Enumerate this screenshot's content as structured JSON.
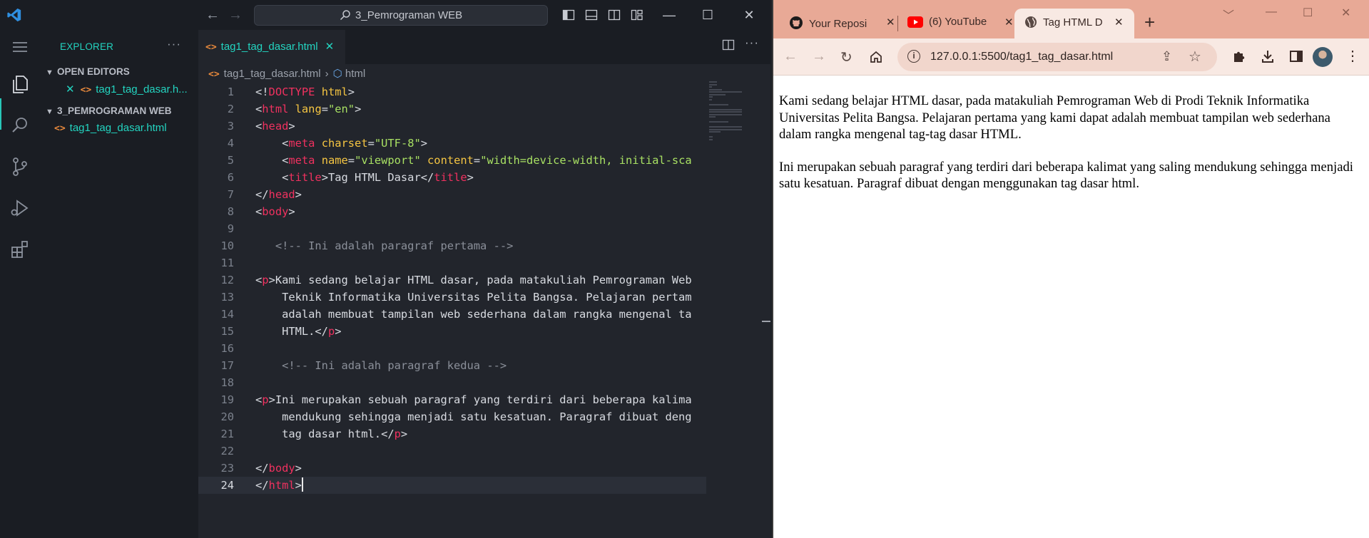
{
  "vscode": {
    "search_text": "3_Pemrograman WEB",
    "explorer_title": "EXPLORER",
    "open_editors_label": "OPEN EDITORS",
    "open_editor_file": "tag1_tag_dasar.h...",
    "folder_label": "3_PEMROGRAMAN WEB",
    "folder_file": "tag1_tag_dasar.html",
    "active_tab": "tag1_tag_dasar.html",
    "breadcrumb": {
      "file": "tag1_tag_dasar.html",
      "symbol": "html"
    },
    "code_lines": [
      "<!DOCTYPE html>",
      "<html lang=\"en\">",
      "<head>",
      "    <meta charset=\"UTF-8\">",
      "    <meta name=\"viewport\" content=\"width=device-width, initial-sca",
      "    <title>Tag HTML Dasar</title>",
      "</head>",
      "<body>",
      "",
      "   <!-- Ini adalah paragraf pertama -->",
      "",
      "<p>Kami sedang belajar HTML dasar, pada matakuliah Pemrograman Web",
      "    Teknik Informatika Universitas Pelita Bangsa. Pelajaran pertam",
      "    adalah membuat tampilan web sederhana dalam rangka mengenal ta",
      "    HTML.</p>",
      "",
      "    <!-- Ini adalah paragraf kedua -->",
      "",
      "<p>Ini merupakan sebuah paragraf yang terdiri dari beberapa kalima",
      "    mendukung sehingga menjadi satu kesatuan. Paragraf dibuat deng",
      "    tag dasar html.</p>",
      "",
      "</body>",
      "</html>"
    ],
    "current_line": 24,
    "colors": {
      "accent": "#23d4c0",
      "tag": "#f0315f",
      "attr": "#f5c542",
      "string": "#a8e063",
      "comment": "#8a8f99"
    }
  },
  "chrome": {
    "tabs": [
      {
        "label": "Your Reposi",
        "icon": "github-icon"
      },
      {
        "label": "(6) YouTube",
        "icon": "youtube-icon"
      },
      {
        "label": "Tag HTML D",
        "icon": "globe-icon",
        "active": true
      }
    ],
    "url": "127.0.0.1:5500/tag1_tag_dasar.html",
    "page_paragraphs": [
      "Kami sedang belajar HTML dasar, pada matakuliah Pemrograman Web di Prodi Teknik Informatika Universitas Pelita Bangsa. Pelajaran pertama yang kami dapat adalah membuat tampilan web sederhana dalam rangka mengenal tag-tag dasar HTML.",
      "Ini merupakan sebuah paragraf yang terdiri dari beberapa kalimat yang saling mendukung sehingga menjadi satu kesatuan. Paragraf dibuat dengan menggunakan tag dasar html."
    ],
    "colors": {
      "tabstrip": "#e8a996",
      "toolbar": "#f8e9e3"
    }
  }
}
